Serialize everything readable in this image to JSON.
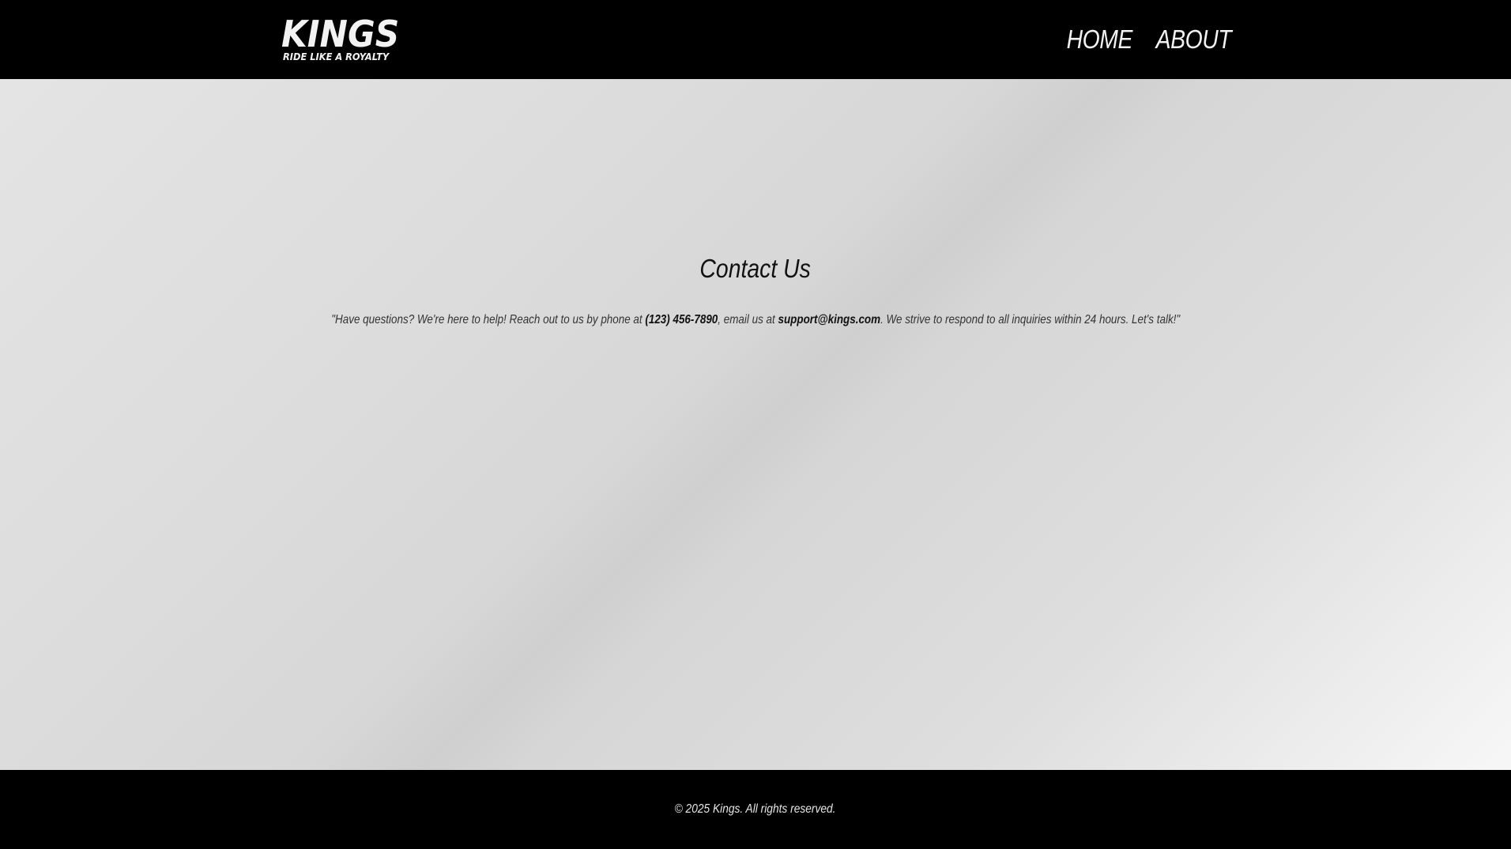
{
  "header": {
    "logo": {
      "name": "KINGS",
      "tagline": "RIDE LIKE A ROYALTY"
    },
    "nav": [
      {
        "label": "HOME"
      },
      {
        "label": "ABOUT"
      }
    ]
  },
  "main": {
    "title": "Contact Us",
    "message": {
      "part1": "\"Have questions? We're here to help! Reach out to us by phone at ",
      "phone": "(123) 456-7890",
      "part2": ", email us at ",
      "email": "support@kings.com",
      "part3": ". We strive to respond to all inquiries within 24 hours. Let's talk!\""
    }
  },
  "footer": {
    "copyright": "© 2025 Kings. All rights reserved."
  },
  "colors": {
    "bar_background": "#000000",
    "bar_text": "#f2f2f2",
    "body_gradient_light": "#e4e4e4",
    "body_gradient_dark": "#cfcfcf"
  }
}
